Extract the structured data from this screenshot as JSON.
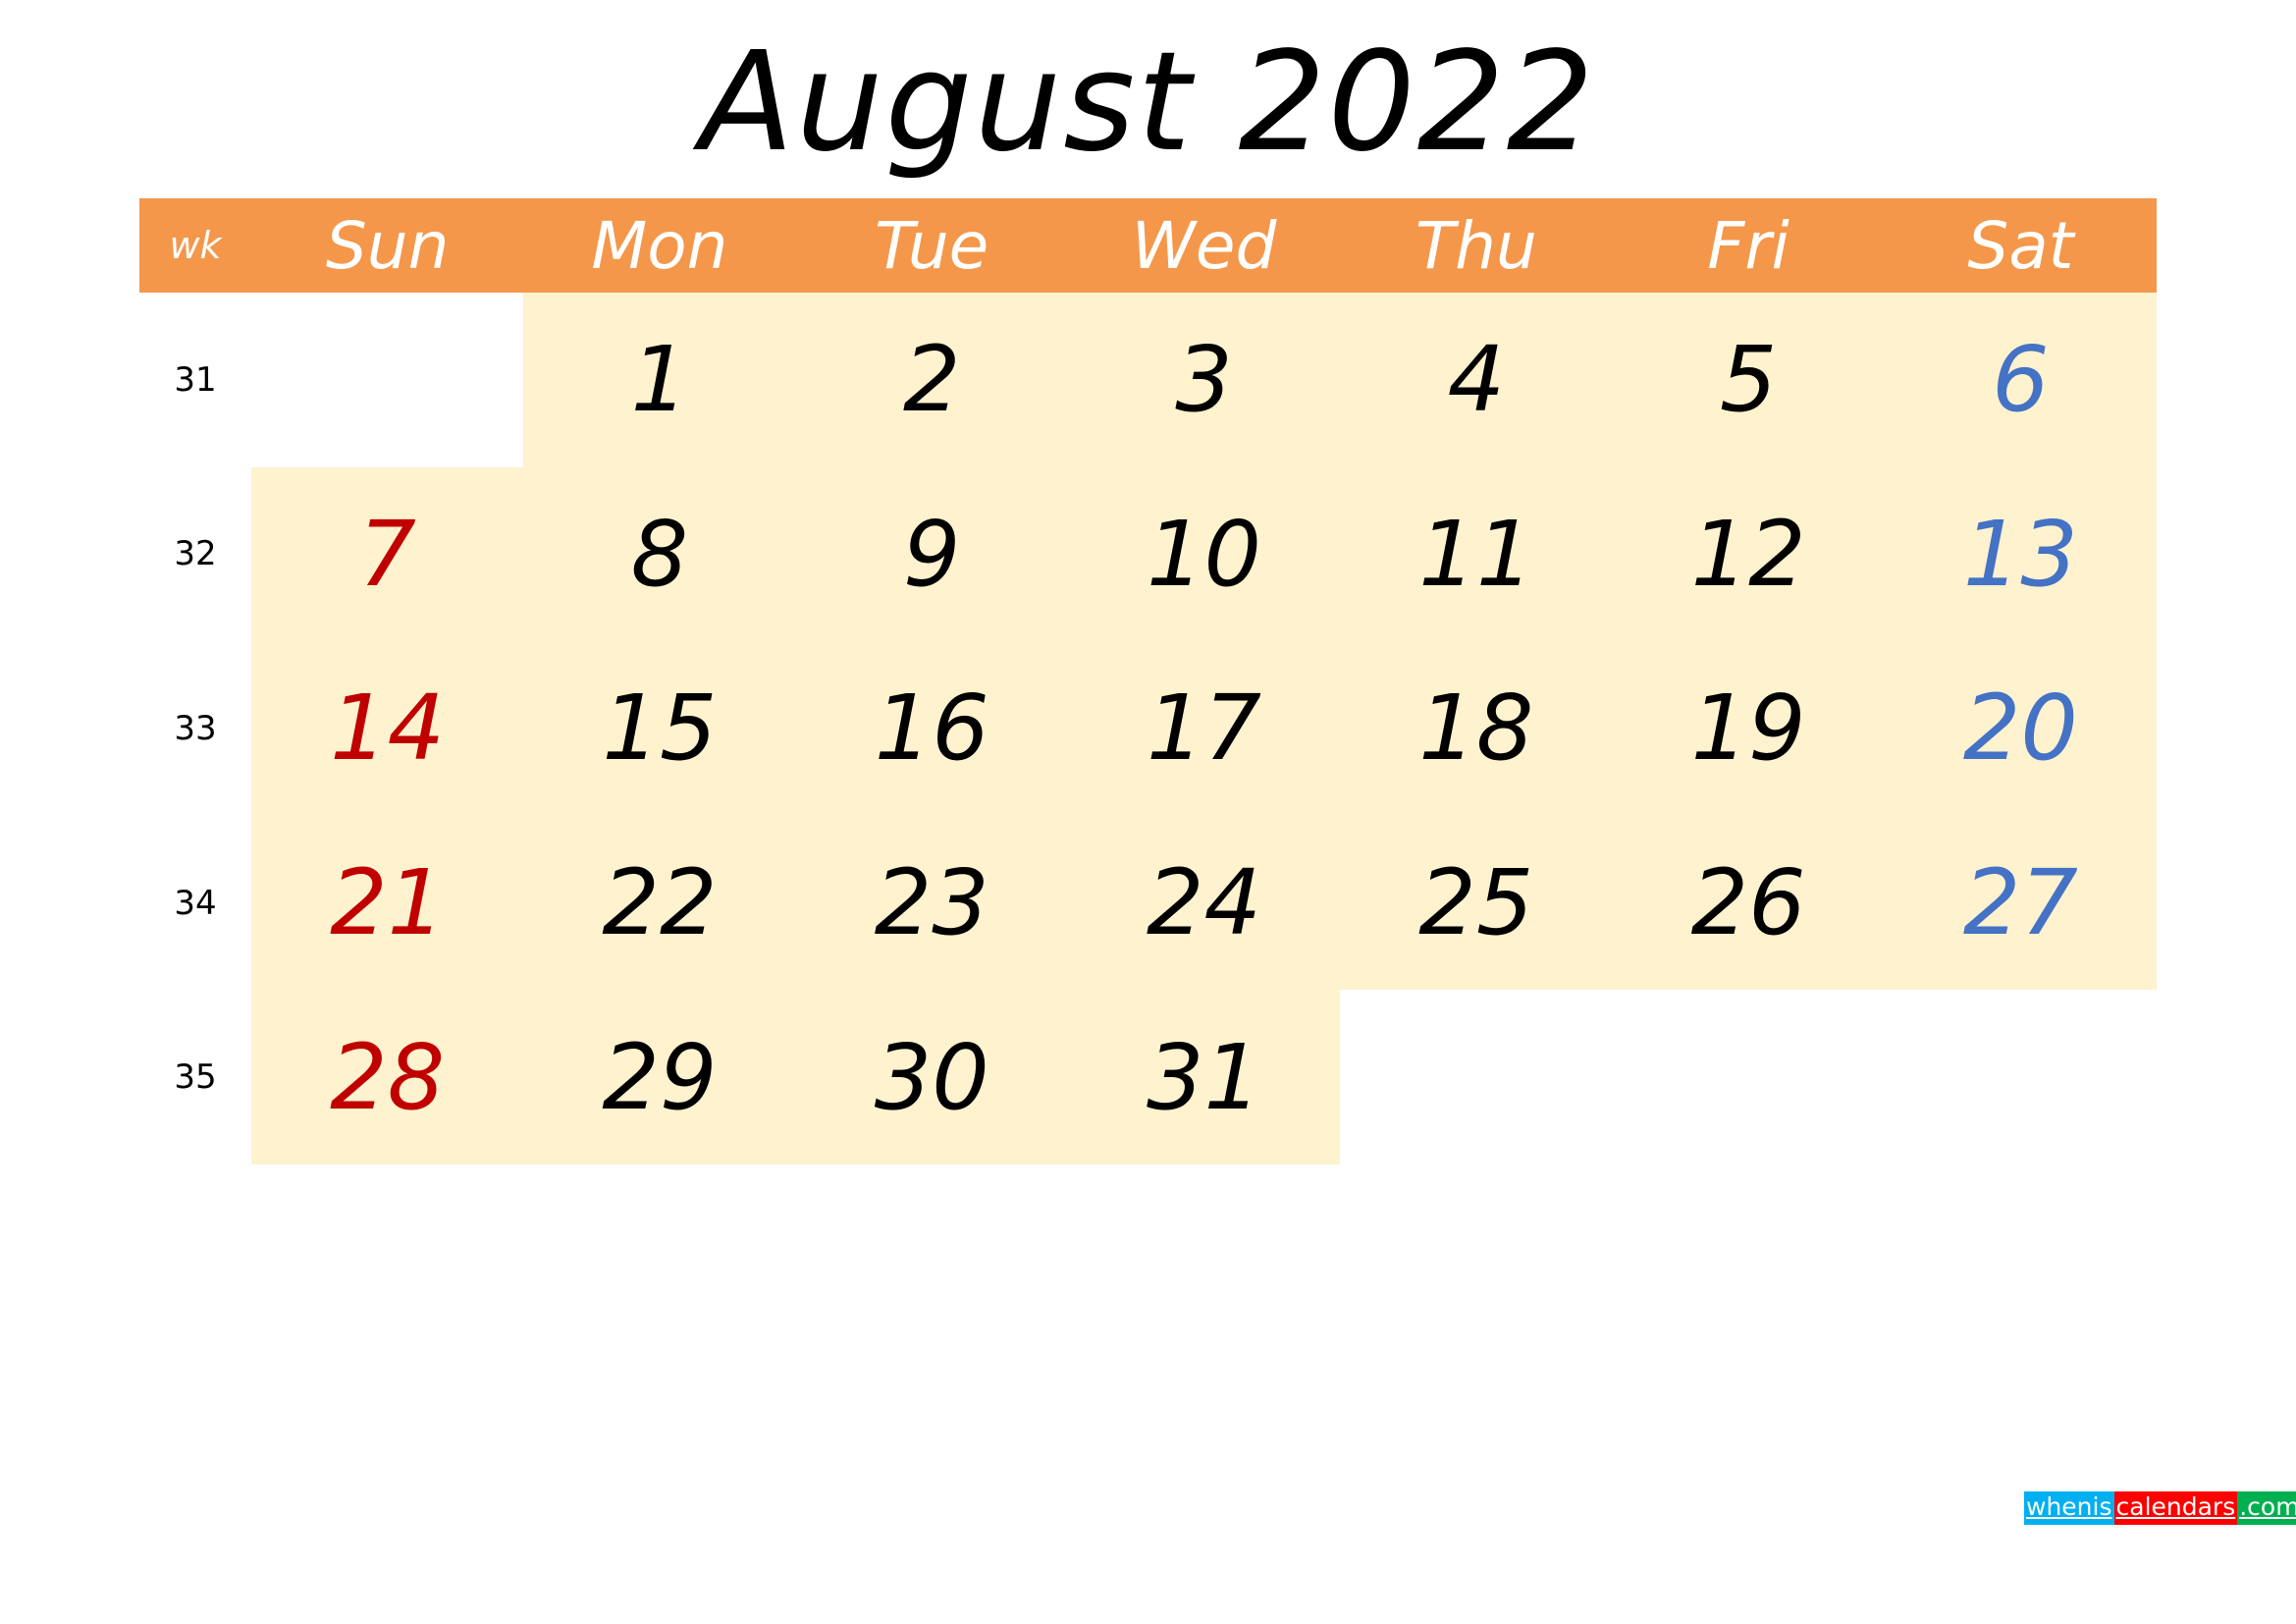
{
  "title": "August 2022",
  "header": {
    "week_label": "wk",
    "days": [
      "Sun",
      "Mon",
      "Tue",
      "Wed",
      "Thu",
      "Fri",
      "Sat"
    ]
  },
  "colors": {
    "header_bg": "#F4974A",
    "cell_bg": "#FEF2CF",
    "sunday": "#C00000",
    "saturday": "#4472C4",
    "weekday": "#000000"
  },
  "weeks": [
    {
      "wk": "31",
      "days": [
        "",
        "1",
        "2",
        "3",
        "4",
        "5",
        "6"
      ]
    },
    {
      "wk": "32",
      "days": [
        "7",
        "8",
        "9",
        "10",
        "11",
        "12",
        "13"
      ]
    },
    {
      "wk": "33",
      "days": [
        "14",
        "15",
        "16",
        "17",
        "18",
        "19",
        "20"
      ]
    },
    {
      "wk": "34",
      "days": [
        "21",
        "22",
        "23",
        "24",
        "25",
        "26",
        "27"
      ]
    },
    {
      "wk": "35",
      "days": [
        "28",
        "29",
        "30",
        "31",
        "",
        "",
        ""
      ]
    }
  ],
  "logo": {
    "part1": "whenis",
    "part2": "calendars",
    "part3": ".com"
  }
}
